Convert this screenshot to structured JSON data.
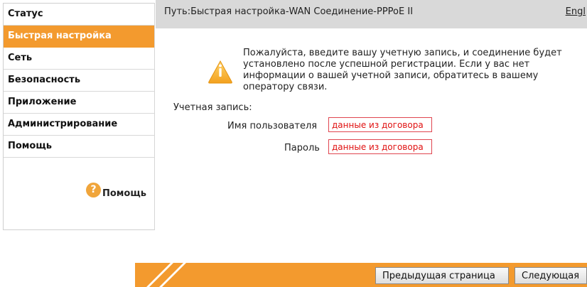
{
  "sidebar": {
    "items": [
      {
        "label": "Статус",
        "active": false
      },
      {
        "label": "Быстрая настройка",
        "active": true
      },
      {
        "label": "Сеть",
        "active": false
      },
      {
        "label": "Безопасность",
        "active": false
      },
      {
        "label": "Приложение",
        "active": false
      },
      {
        "label": "Администрирование",
        "active": false
      },
      {
        "label": "Помощь",
        "active": false
      }
    ],
    "help_label": "Помощь",
    "help_icon": "question-icon"
  },
  "header": {
    "path": "Путь:Быстрая настройка-WAN Соединение-PPPoE II",
    "language_link": "Engl"
  },
  "notice": {
    "icon": "warning-icon",
    "text": "Пожалуйста, введите вашу учетную запись, и соединение будет установлено после успешной регистрации. Если у вас нет информации о вашей учетной записи, обратитесь в вашему оператору связи."
  },
  "form": {
    "account_label": "Учетная запись:",
    "username_label": "Имя пользователя",
    "username_value": "данные из договора",
    "password_label": "Пароль",
    "password_value": "данные из договора"
  },
  "footer": {
    "prev_button": "Предыдущая страница",
    "next_button": "Следующая"
  },
  "colors": {
    "accent": "#f39a2e",
    "input_border": "#e0454f",
    "input_text": "#e01010",
    "header_bg": "#d9d9d9"
  }
}
